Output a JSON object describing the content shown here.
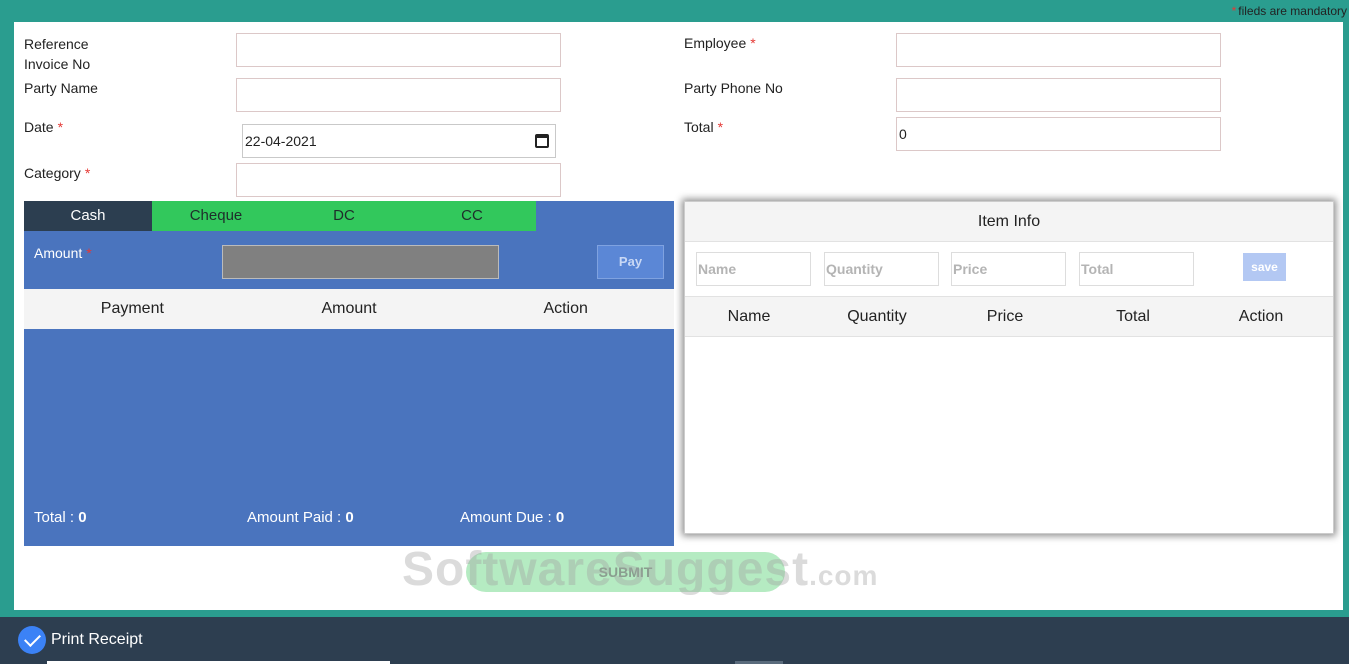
{
  "header": {
    "mandatory_note": "fileds are mandatory",
    "star": "*"
  },
  "form": {
    "reference_invoice_label": "Reference\nInvoice No",
    "reference_invoice_value": "",
    "party_name_label": "Party Name",
    "party_name_value": "",
    "date_label": "Date",
    "date_value": "22-04-2021",
    "category_label": "Category",
    "category_value": "",
    "employee_label": "Employee",
    "employee_value": "",
    "party_phone_label": "Party Phone No",
    "party_phone_value": "",
    "total_label": "Total",
    "total_value": "0",
    "required_mark": "*"
  },
  "payment": {
    "tabs": [
      "Cash",
      "Cheque",
      "DC",
      "CC"
    ],
    "active_tab": "Cash",
    "amount_label": "Amount",
    "amount_value": "",
    "pay_button": "Pay",
    "columns": [
      "Payment",
      "Amount",
      "Action"
    ],
    "rows": [],
    "total_label": "Total : ",
    "total_value": "0",
    "amount_paid_label": "Amount Paid : ",
    "amount_paid_value": "0",
    "amount_due_label": "Amount Due : ",
    "amount_due_value": "0"
  },
  "item_info": {
    "title": "Item Info",
    "name_placeholder": "Name",
    "quantity_placeholder": "Quantity",
    "price_placeholder": "Price",
    "total_placeholder": "Total",
    "save_button": "save",
    "columns": [
      "Name",
      "Quantity",
      "Price",
      "Total",
      "Action"
    ],
    "rows": []
  },
  "submit_button": "SUBMIT",
  "watermark": {
    "main": "SoftwareSuggest",
    "suffix": ".com"
  },
  "bottom_bar": {
    "print_receipt_label": "Print Receipt",
    "checked": true
  },
  "colors": {
    "background": "#2a9d8f",
    "payment_panel": "#4a74be",
    "tab_active": "#2c3e50",
    "tab_inactive": "#32c85c",
    "required_star": "#e53935",
    "bottom_bar": "#2d3e50"
  }
}
